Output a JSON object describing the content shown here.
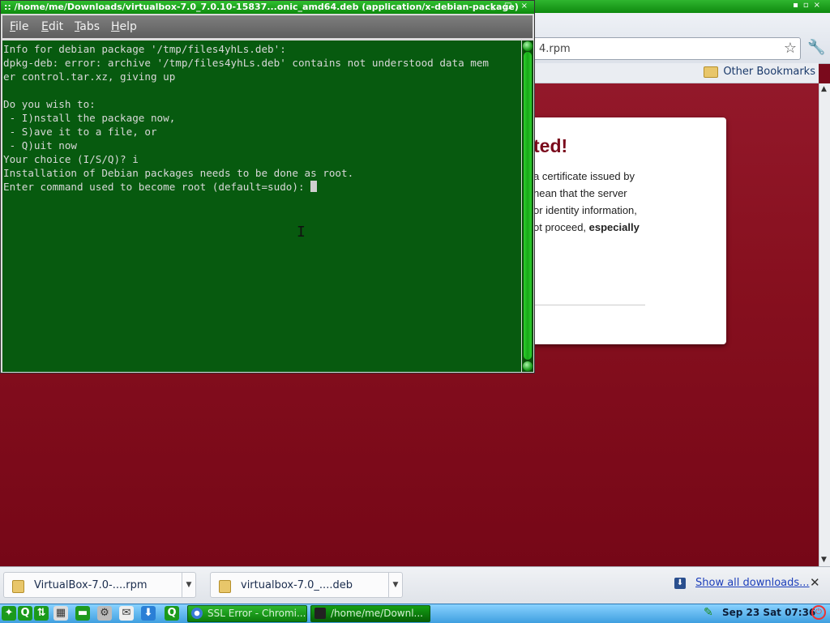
{
  "chrome": {
    "address_text": "4.rpm",
    "other_bookmarks": "Other Bookmarks",
    "ssl": {
      "title": "ted!",
      "line1": "a certificate issued by",
      "line2": "nean that the server",
      "line3": "or identity information,",
      "line4_pre": "ot proceed, ",
      "line4_bold": "especially"
    }
  },
  "downloads": {
    "items": [
      {
        "name": "VirtualBox-7.0-....rpm"
      },
      {
        "name": "virtualbox-7.0_....deb"
      }
    ],
    "show_all": "Show all downloads...",
    "close": "✕"
  },
  "terminal": {
    "title": ":: /home/me/Downloads/virtualbox-7.0_7.0.10-15837...onic_amd64.deb (application/x-debian-package)",
    "controls": "_ □ ×",
    "menu": [
      {
        "first": "F",
        "rest": "ile"
      },
      {
        "first": "E",
        "rest": "dit"
      },
      {
        "first": "T",
        "rest": "abs"
      },
      {
        "first": "H",
        "rest": "elp"
      }
    ],
    "output": "Info for debian package '/tmp/files4yhLs.deb':\ndpkg-deb: error: archive '/tmp/files4yhLs.deb' contains not understood data mem\ner control.tar.xz, giving up\n\nDo you wish to:\n - I)nstall the package now,\n - S)ave it to a file, or\n - Q)uit now\nYour choice (I/S/Q)? i\nInstallation of Debian packages needs to be done as root.\nEnter command used to become root (default=sudo): "
  },
  "taskbar": {
    "tasks": [
      {
        "label": "SSL Error - Chromi..."
      },
      {
        "label": "/home/me/Downl..."
      }
    ],
    "clock": "Sep 23 Sat 07:36"
  },
  "colors": {
    "terminal_bg": "#075a0f",
    "titlebar_green": "#0e8a0e",
    "page_red": "#87101f",
    "taskbar_blue": "#3f9fe0"
  }
}
